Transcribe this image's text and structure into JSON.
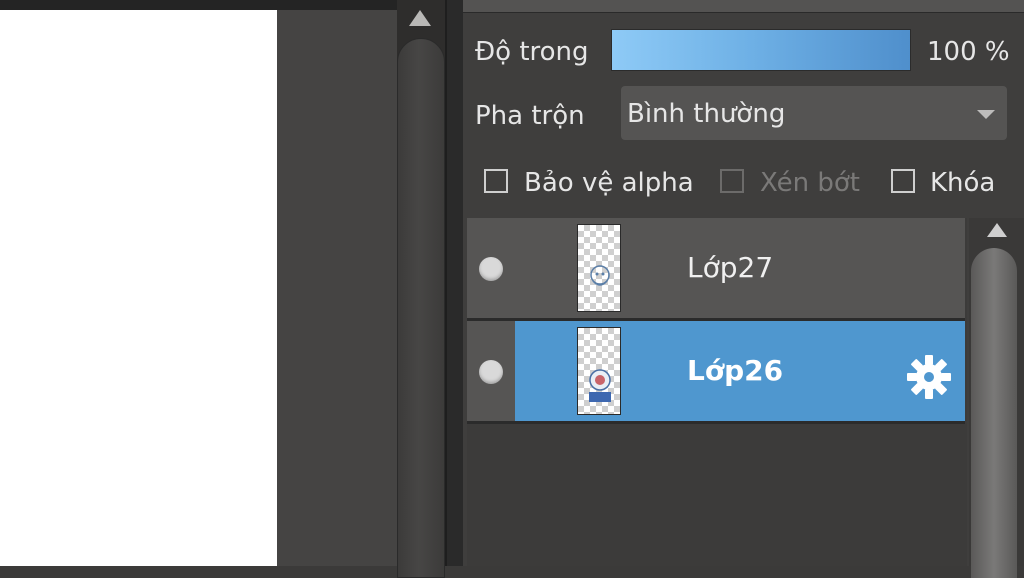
{
  "layer_panel": {
    "opacity_label": "Độ trong",
    "opacity_value": "100 %",
    "opacity_fraction": 1.0,
    "blend_label": "Pha trộn",
    "blend_mode": "Bình thường",
    "checkbox_alpha_label": "Bảo vệ alpha",
    "checkbox_clip_label": "Xén bớt",
    "checkbox_lock_label": "Khóa",
    "layers": [
      {
        "name": "Lớp27",
        "selected": false
      },
      {
        "name": "Lớp26",
        "selected": true
      }
    ],
    "accent_color": "#4f97cf"
  },
  "icons": {
    "visibility": "visibility-dot-icon",
    "settings": "gear-icon",
    "scroll_up": "scroll-up-arrow-icon",
    "dropdown": "chevron-down-icon"
  }
}
